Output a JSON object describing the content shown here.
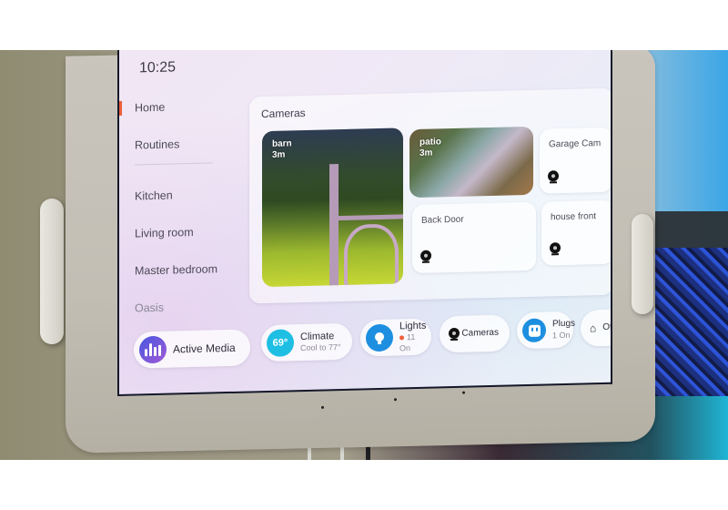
{
  "screen": {
    "clock": "10:25"
  },
  "sidebar": {
    "items": [
      {
        "label": "Home",
        "active": true
      },
      {
        "label": "Routines",
        "active": false
      },
      {
        "label": "Kitchen",
        "active": false
      },
      {
        "label": "Living room",
        "active": false
      },
      {
        "label": "Master bedroom",
        "active": false
      },
      {
        "label": "Oasis",
        "active": false
      }
    ]
  },
  "cameras": {
    "title": "Cameras",
    "tiles": [
      {
        "name": "barn",
        "age": "3m",
        "live": true
      },
      {
        "name": "patio",
        "age": "3m",
        "live": true
      },
      {
        "name": "Garage Cam",
        "icon": "camera-icon"
      },
      {
        "name": "Back Door",
        "icon": "camera-icon"
      },
      {
        "name": "house front",
        "icon": "camera-icon"
      }
    ]
  },
  "dock": {
    "active_media": {
      "label": "Active Media",
      "icon": "equalizer-icon"
    },
    "climate": {
      "badge": "69°",
      "label": "Climate",
      "sub": "Cool to 77°"
    },
    "lights": {
      "label": "Lights",
      "sub": "11 On",
      "icon": "lightbulb-icon"
    },
    "cameras": {
      "label": "Cameras",
      "icon": "camera-icon"
    },
    "plugs": {
      "label": "Plugs",
      "sub": "1 On",
      "icon": "plug-icon"
    },
    "other": {
      "label": "Ot",
      "icon": "house-icon"
    }
  },
  "colors": {
    "accent_active": "#ee5e3a",
    "climate_badge": "#1fbfe4",
    "lights_badge": "#1e8fe0",
    "plugs_badge": "#1e8fe0",
    "lights_dot": "#ee5e3a"
  }
}
